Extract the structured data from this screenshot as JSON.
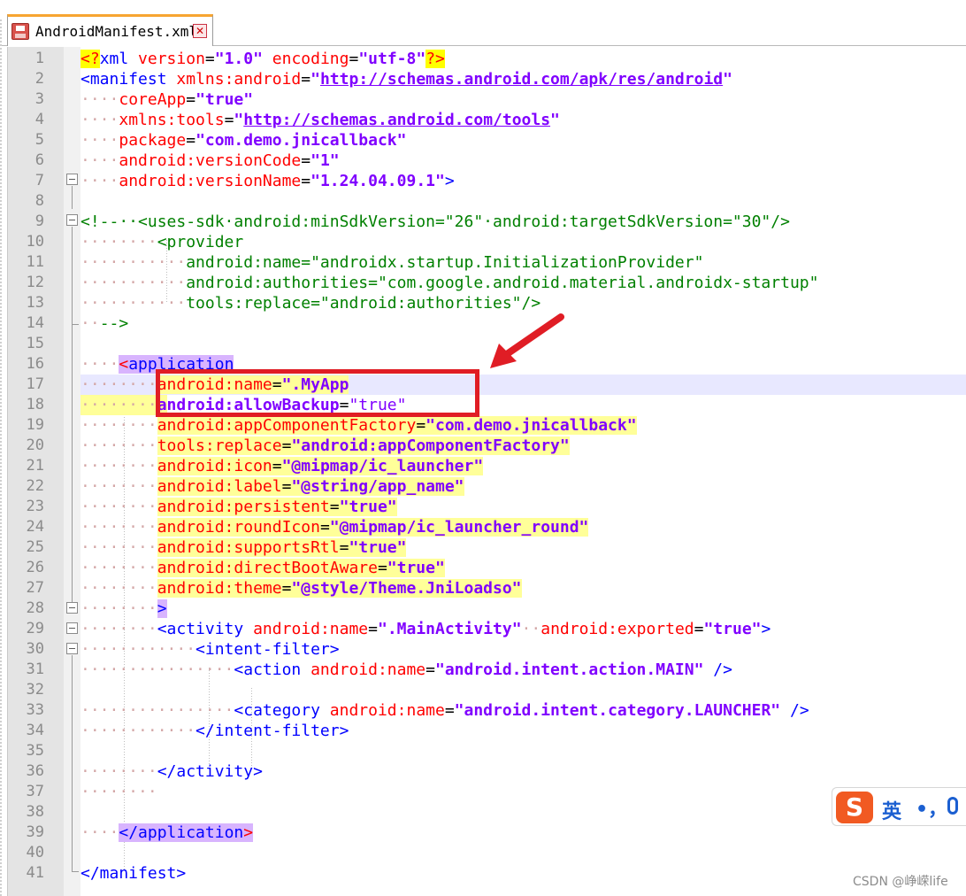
{
  "tab": {
    "title": "AndroidManifest.xml",
    "close_glyph": "✕",
    "icon": "save-file-icon"
  },
  "line_numbers": [
    "1",
    "2",
    "3",
    "4",
    "5",
    "6",
    "7",
    "8",
    "9",
    "10",
    "11",
    "12",
    "13",
    "14",
    "15",
    "16",
    "17",
    "18",
    "19",
    "20",
    "21",
    "22",
    "23",
    "24",
    "25",
    "26",
    "27",
    "28",
    "29",
    "30",
    "31",
    "32",
    "33",
    "34",
    "35",
    "36",
    "37",
    "38",
    "39",
    "40",
    "41"
  ],
  "code": {
    "l1": [
      "<?",
      "xml",
      " ",
      "version",
      "=",
      "\"1.0\"",
      " ",
      "encoding",
      "=",
      "\"utf-8\"",
      "?>"
    ],
    "l2": [
      "<manifest",
      " ",
      "xmlns:android",
      "=",
      "\"",
      "http://schemas.android.com/apk/res/android",
      "\""
    ],
    "l3": [
      "····",
      "coreApp",
      "=",
      "\"true\""
    ],
    "l4": [
      "····",
      "xmlns:tools",
      "=",
      "\"",
      "http://schemas.android.com/tools",
      "\""
    ],
    "l5": [
      "····",
      "package",
      "=",
      "\"com.demo.jnicallback\""
    ],
    "l6": [
      "····",
      "android:versionCode",
      "=",
      "\"1\""
    ],
    "l7": [
      "····",
      "android:versionName",
      "=",
      "\"1.24.04.09.1\"",
      ">"
    ],
    "l9": [
      "<!--··<uses-sdk·android:minSdkVersion=\"26\"·android:targetSdkVersion=\"30\"/>"
    ],
    "l10": [
      "········",
      "<provider"
    ],
    "l11": [
      "···········",
      "android:name=\"androidx.startup.InitializationProvider\""
    ],
    "l12": [
      "···········",
      "android:authorities=\"com.google.android.material.androidx-startup\""
    ],
    "l13": [
      "···········",
      "tools:replace=\"android:authorities\"/>"
    ],
    "l14": [
      "··",
      "-->"
    ],
    "l16": [
      "····",
      "<",
      "application"
    ],
    "l17": [
      "········",
      "android:name",
      "=",
      "\".MyApp"
    ],
    "l18": [
      "········",
      "android:allowBackup",
      "=",
      "\"true\""
    ],
    "l19": [
      "········",
      "android:appComponentFactory",
      "=",
      "\"com.demo.jnicallback\""
    ],
    "l20": [
      "········",
      "tools:replace",
      "=",
      "\"android:appComponentFactory\""
    ],
    "l21": [
      "········",
      "android:icon",
      "=",
      "\"@mipmap/ic_launcher\""
    ],
    "l22": [
      "········",
      "android:label",
      "=",
      "\"@string/app_name\""
    ],
    "l23": [
      "········",
      "android:persistent",
      "=",
      "\"true\""
    ],
    "l24": [
      "········",
      "android:roundIcon",
      "=",
      "\"@mipmap/ic_launcher_round\""
    ],
    "l25": [
      "········",
      "android:supportsRtl",
      "=",
      "\"true\""
    ],
    "l26": [
      "········",
      "android:directBootAware",
      "=",
      "\"true\""
    ],
    "l27": [
      "········",
      "android:theme",
      "=",
      "\"@style/Theme.JniLoadso\""
    ],
    "l28": [
      "········",
      ">"
    ],
    "l29": [
      "········",
      "<activity",
      " ",
      "android:name",
      "=",
      "\".MainActivity\"",
      "··",
      "android:exported",
      "=",
      "\"true\"",
      ">"
    ],
    "l30": [
      "············",
      "<intent-filter>"
    ],
    "l31": [
      "················",
      "<action",
      " ",
      "android:name",
      "=",
      "\"android.intent.action.MAIN\"",
      " ",
      "/>"
    ],
    "l33": [
      "················",
      "<category",
      " ",
      "android:name",
      "=",
      "\"android.intent.category.LAUNCHER\"",
      " ",
      "/>"
    ],
    "l34": [
      "············",
      "</intent-filter>"
    ],
    "l36": [
      "········",
      "</activity>"
    ],
    "l37": [
      "········"
    ],
    "l39": [
      "····",
      "</application",
      ">"
    ],
    "l41": [
      "</manifest>"
    ]
  },
  "ime": {
    "logo": "S",
    "lang": "英",
    "punct": "•，",
    "mic_icon": "microphone-icon"
  },
  "watermark": "CSDN @峥嵘life",
  "colors": {
    "tag": "#0000ff",
    "attribute": "#ff0000",
    "value": "#8000ff",
    "comment": "#008000",
    "annotation": "#e01d25",
    "yellow_highlight": "#ffff99",
    "purple_highlight": "#d8b4fe"
  }
}
